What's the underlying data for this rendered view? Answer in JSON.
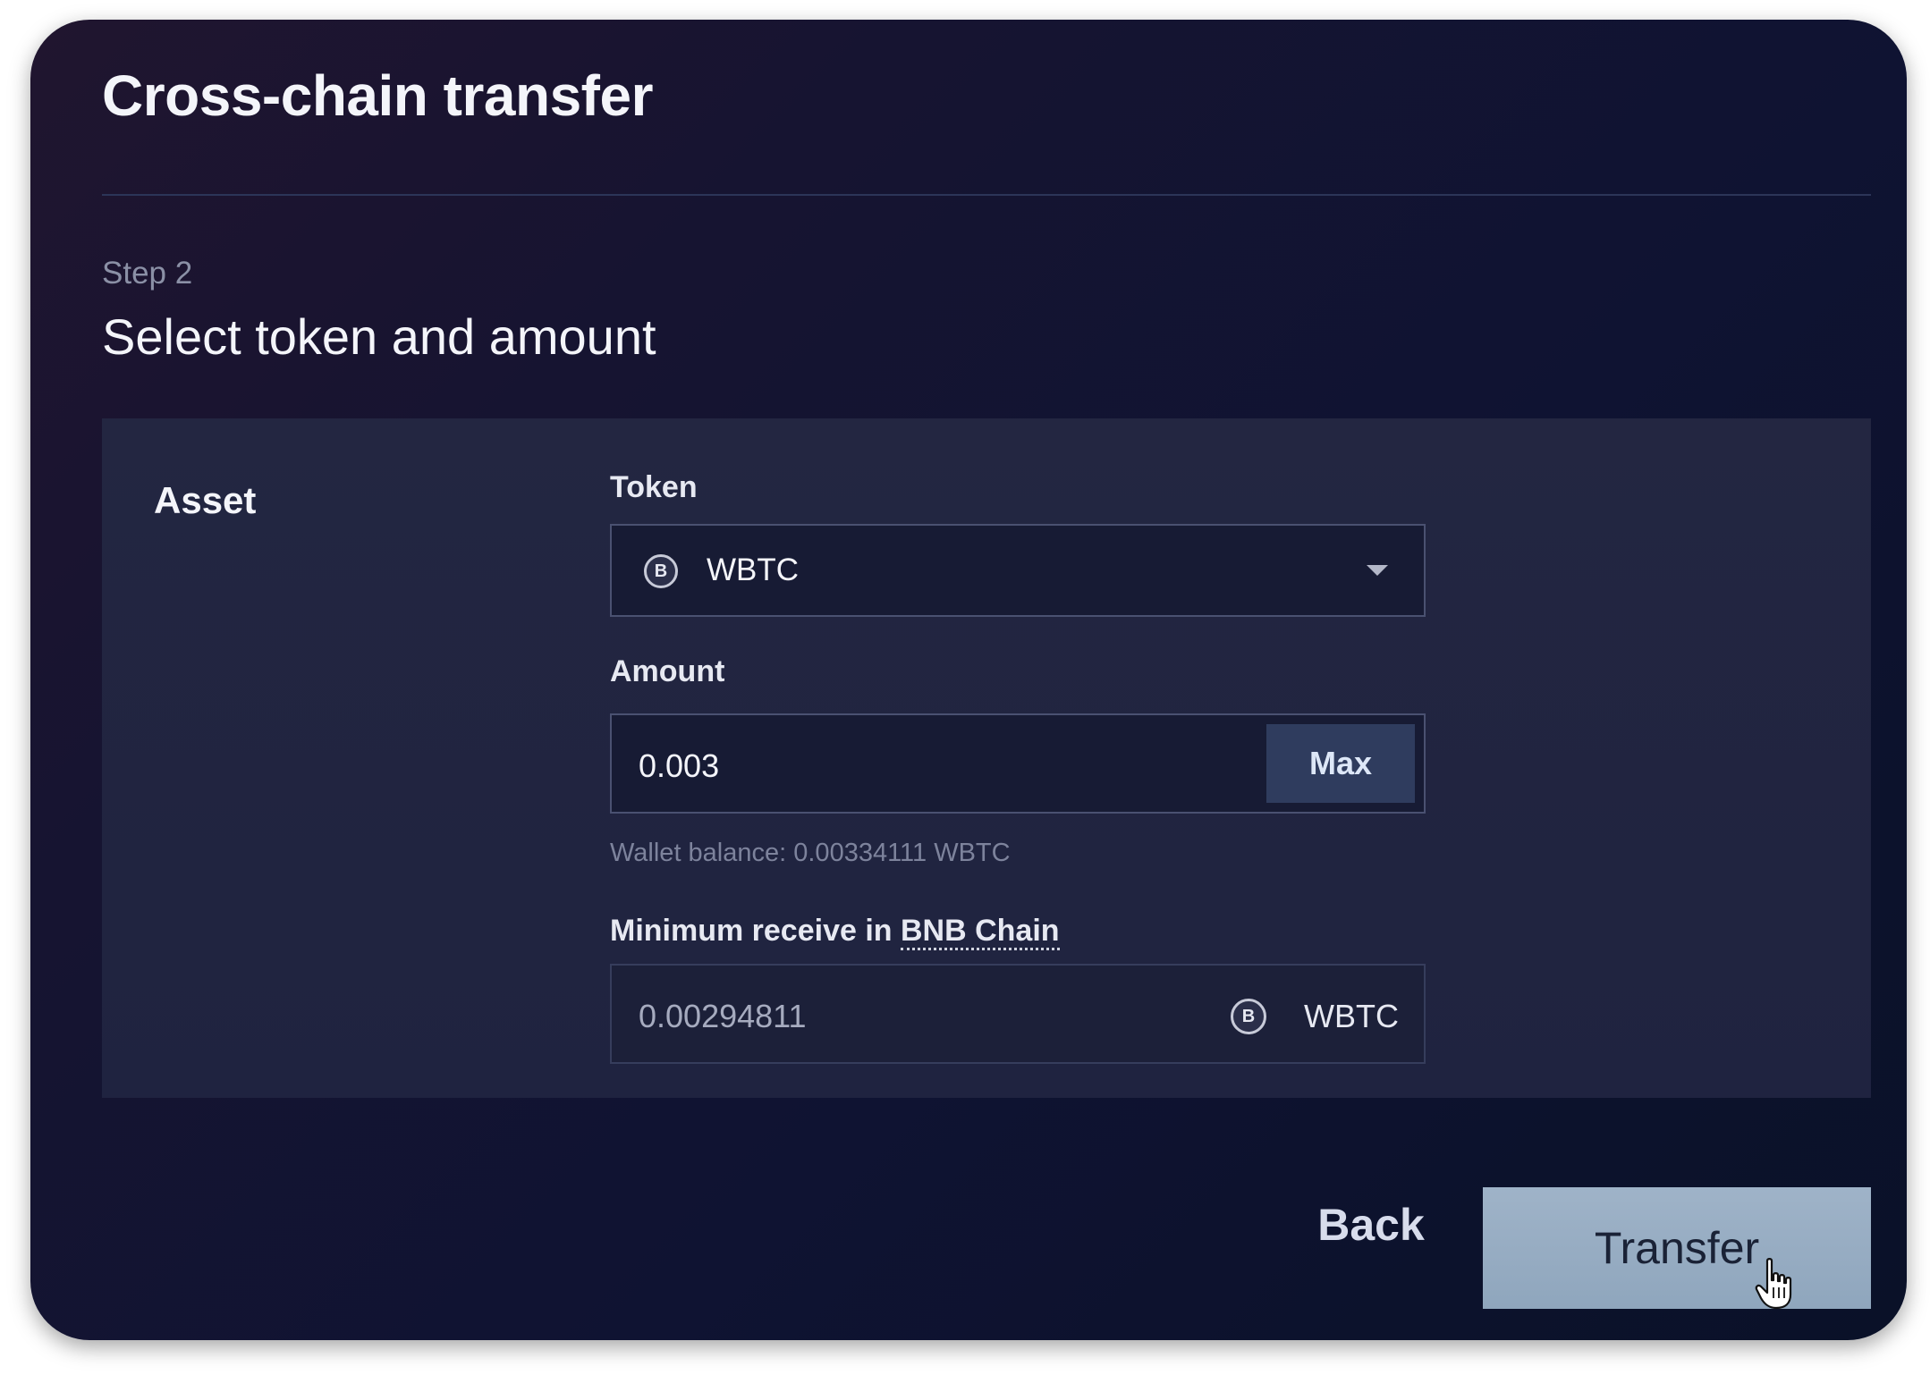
{
  "header": {
    "title": "Cross-chain transfer"
  },
  "step": {
    "label": "Step 2",
    "title": "Select token and amount"
  },
  "asset": {
    "section_title": "Asset",
    "token": {
      "label": "Token",
      "selected": "WBTC",
      "icon": "bitcoin-icon",
      "icon_glyph": "B"
    },
    "amount": {
      "label": "Amount",
      "value": "0.003",
      "max_label": "Max",
      "balance_text": "Wallet balance: 0.00334111 WBTC"
    },
    "minimum_receive": {
      "label_prefix": "Minimum receive in ",
      "chain_name": "BNB Chain",
      "value": "0.00294811",
      "token": "WBTC",
      "icon": "bitcoin-icon",
      "icon_glyph": "B"
    }
  },
  "actions": {
    "back_label": "Back",
    "transfer_label": "Transfer"
  },
  "colors": {
    "background": "#0f1332",
    "panel": "#232641",
    "accent_button": "#9fb3c8",
    "max_button": "#2f3c5e"
  }
}
